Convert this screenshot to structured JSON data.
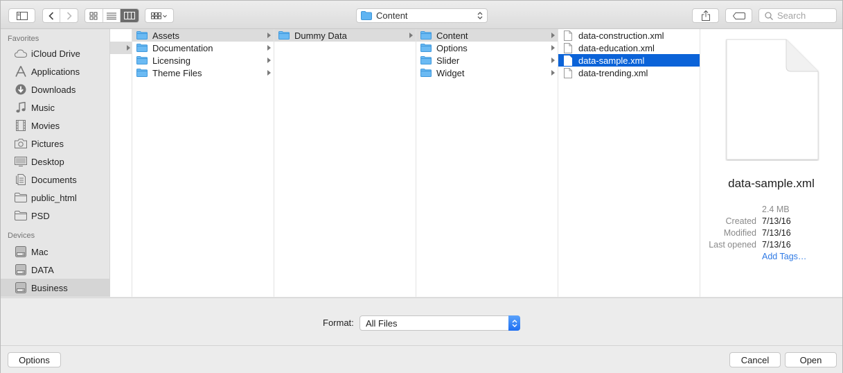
{
  "path_popup": {
    "label": "Content"
  },
  "search": {
    "placeholder": "Search"
  },
  "sidebar": {
    "favorites_header": "Favorites",
    "favorites": [
      {
        "label": "iCloud Drive",
        "icon": "cloud-icon"
      },
      {
        "label": "Applications",
        "icon": "applications-icon"
      },
      {
        "label": "Downloads",
        "icon": "downloads-icon"
      },
      {
        "label": "Music",
        "icon": "music-icon"
      },
      {
        "label": "Movies",
        "icon": "movies-icon"
      },
      {
        "label": "Pictures",
        "icon": "camera-icon"
      },
      {
        "label": "Desktop",
        "icon": "desktop-icon"
      },
      {
        "label": "Documents",
        "icon": "documents-icon"
      },
      {
        "label": "public_html",
        "icon": "folder-icon"
      },
      {
        "label": "PSD",
        "icon": "folder-icon"
      }
    ],
    "devices_header": "Devices",
    "devices": [
      {
        "label": "Mac",
        "icon": "disk-icon"
      },
      {
        "label": "DATA",
        "icon": "disk-icon"
      },
      {
        "label": "Business",
        "icon": "disk-icon"
      }
    ]
  },
  "columns": {
    "col1": [
      {
        "label": "Assets"
      },
      {
        "label": "Documentation"
      },
      {
        "label": "Licensing"
      },
      {
        "label": "Theme Files"
      }
    ],
    "col2": [
      {
        "label": "Dummy Data"
      }
    ],
    "col3": [
      {
        "label": "Content"
      },
      {
        "label": "Options"
      },
      {
        "label": "Slider"
      },
      {
        "label": "Widget"
      }
    ],
    "col4": [
      {
        "label": "data-construction.xml"
      },
      {
        "label": "data-education.xml"
      },
      {
        "label": "data-sample.xml"
      },
      {
        "label": "data-trending.xml"
      }
    ]
  },
  "preview": {
    "name": "data-sample.xml",
    "size": "2.4 MB",
    "created_label": "Created",
    "created": "7/13/16",
    "modified_label": "Modified",
    "modified": "7/13/16",
    "last_opened_label": "Last opened",
    "last_opened": "7/13/16",
    "add_tags": "Add Tags…"
  },
  "format": {
    "label": "Format:",
    "value": "All Files"
  },
  "buttons": {
    "options": "Options",
    "cancel": "Cancel",
    "open": "Open"
  },
  "colors": {
    "selection": "#0b63d8",
    "folder": "#5fb4f2",
    "link": "#2f7ae5"
  }
}
